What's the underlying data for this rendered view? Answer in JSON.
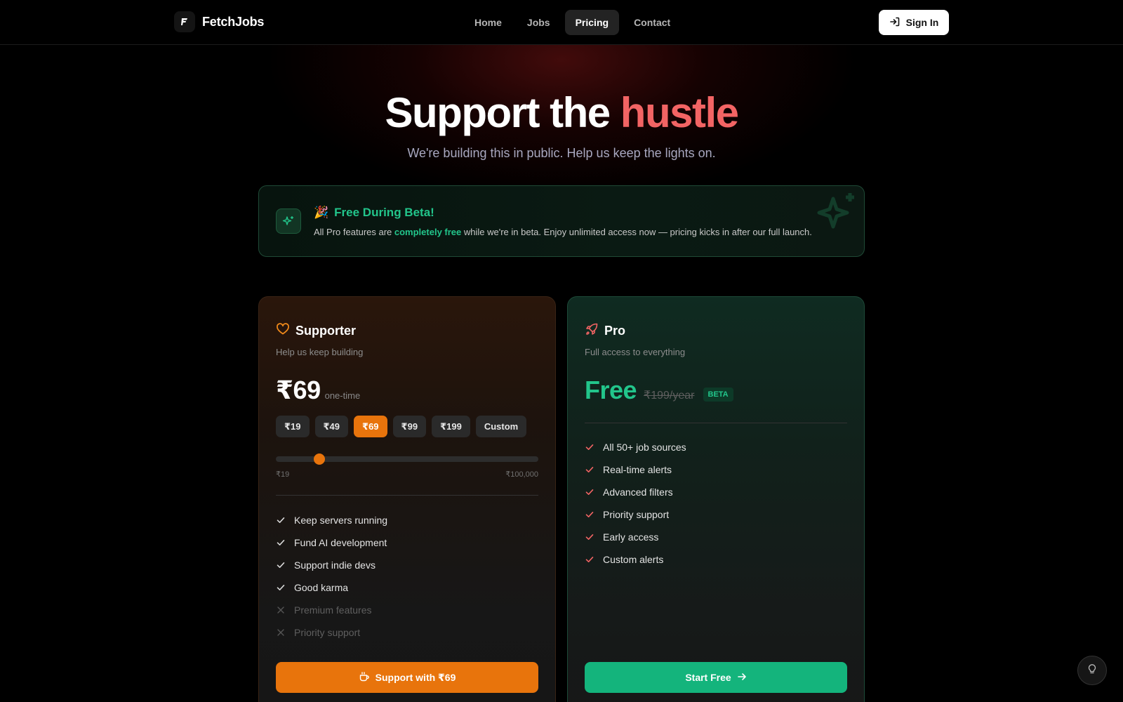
{
  "brand": {
    "name": "FetchJobs"
  },
  "nav": {
    "items": [
      {
        "label": "Home"
      },
      {
        "label": "Jobs"
      },
      {
        "label": "Pricing"
      },
      {
        "label": "Contact"
      }
    ],
    "active": "Pricing",
    "signin_label": "Sign In"
  },
  "hero": {
    "title_main": "Support the ",
    "title_accent": "hustle",
    "subtitle": "We're building this in public. Help us keep the lights on."
  },
  "banner": {
    "emoji": "🎉",
    "title": "Free During Beta!",
    "text_before": "All Pro features are ",
    "text_highlight": "completely free",
    "text_after": " while we're in beta. Enjoy unlimited access now — pricing kicks in after our full launch."
  },
  "supporter": {
    "name": "Supporter",
    "description": "Help us keep building",
    "price": "₹69",
    "price_note": "one-time",
    "amounts": [
      "₹19",
      "₹49",
      "₹69",
      "₹99",
      "₹199",
      "Custom"
    ],
    "selected_amount": "₹69",
    "slider": {
      "min_label": "₹19",
      "max_label": "₹100,000",
      "level": 0.165
    },
    "features": [
      {
        "label": "Keep servers running",
        "included": true
      },
      {
        "label": "Fund AI development",
        "included": true
      },
      {
        "label": "Support indie devs",
        "included": true
      },
      {
        "label": "Good karma",
        "included": true
      },
      {
        "label": "Premium features",
        "included": false
      },
      {
        "label": "Priority support",
        "included": false
      }
    ],
    "cta_label": "Support with ₹69",
    "accent_color": "#e8740c"
  },
  "pro": {
    "name": "Pro",
    "description": "Full access to everything",
    "price": "Free",
    "original_price": "₹199/year",
    "badge": "BETA",
    "features": [
      {
        "label": "All 50+ job sources"
      },
      {
        "label": "Real-time alerts"
      },
      {
        "label": "Advanced filters"
      },
      {
        "label": "Priority support"
      },
      {
        "label": "Early access"
      },
      {
        "label": "Custom alerts"
      }
    ],
    "cta_label": "Start Free",
    "accent_color": "#14b47c"
  },
  "icons": {
    "logo": "fetchjobs-logo-icon",
    "signin": "sign-in-icon",
    "banner": "sparkles-icon",
    "supporter": "heart-icon",
    "pro": "rocket-icon",
    "check": "check-icon",
    "cross": "x-icon",
    "coffee": "coffee-icon",
    "arrow": "arrow-right-icon",
    "help": "lightbulb-icon"
  }
}
